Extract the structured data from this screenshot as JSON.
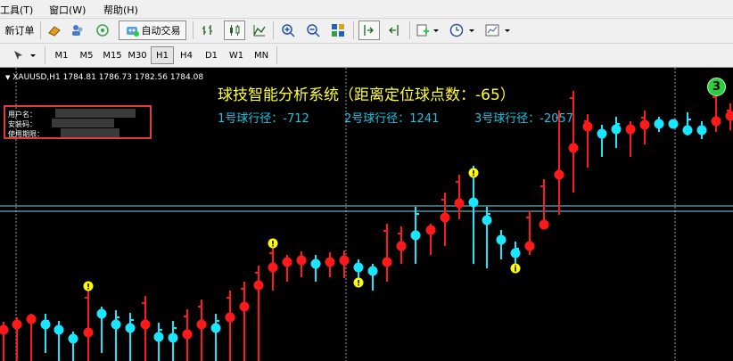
{
  "menu": {
    "tools": "工具(T)",
    "window": "窗口(W)",
    "help": "帮助(H)"
  },
  "toolbar": {
    "new_order": "新订单",
    "auto_trade": "自动交易"
  },
  "timeframes": [
    "M1",
    "M5",
    "M15",
    "M30",
    "H1",
    "H4",
    "D1",
    "W1",
    "MN"
  ],
  "active_timeframe": "H1",
  "chart": {
    "symbol_line": "XAUUSD,H1  1784.81 1786.73 1782.56 1784.08",
    "panel": {
      "user_label": "用户名：",
      "install_label": "安装码：",
      "expiry_label": "使用期限："
    },
    "headline": "球技智能分析系统（距离定位球点数：-65）",
    "track1": "1号球行径：-712",
    "track2": "2号球行径：1241",
    "track3": "3号球行径：-2057",
    "badge": "3",
    "marker_char": "!",
    "marker_char2": "i",
    "colors": {
      "up": "#ff1a1a",
      "down": "#19e6ff",
      "marker": "#ffff00",
      "badge": "#2ecc40"
    }
  }
}
